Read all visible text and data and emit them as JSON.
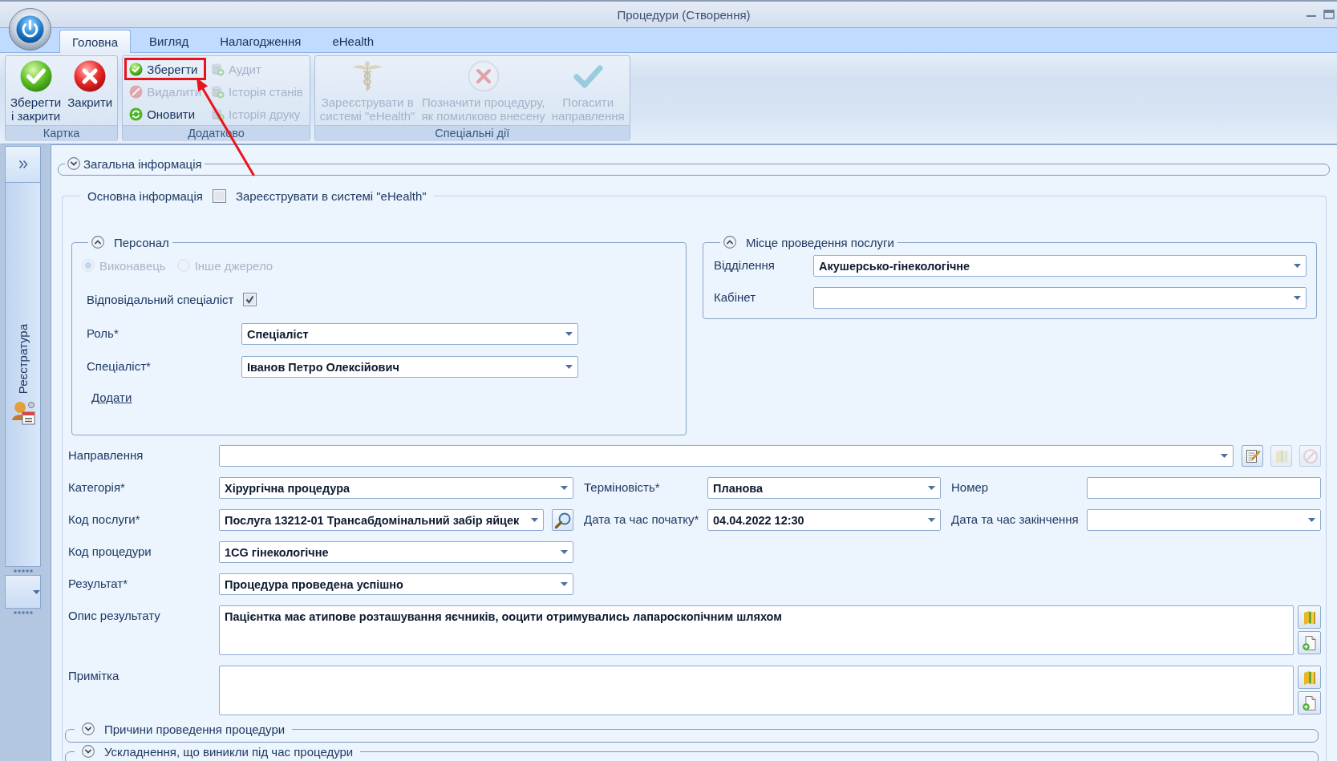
{
  "window": {
    "title": "Процедури (Створення)"
  },
  "tabs": [
    {
      "label": "Головна",
      "selected": true
    },
    {
      "label": "Вигляд",
      "selected": false
    },
    {
      "label": "Налагодження",
      "selected": false
    },
    {
      "label": "eHealth",
      "selected": false
    }
  ],
  "ribbon": {
    "groups": [
      {
        "label": "Картка",
        "kind": "large",
        "buttons": [
          {
            "label": "Зберегти\nі закрити",
            "disabled": false,
            "highlighted": false
          },
          {
            "label": "Закрити",
            "disabled": false,
            "highlighted": false
          }
        ]
      },
      {
        "label": "Додатково",
        "kind": "small",
        "buttons": [
          {
            "label": "Зберегти",
            "disabled": false,
            "highlighted": true
          },
          {
            "label": "Видалити",
            "disabled": true,
            "highlighted": false
          },
          {
            "label": "Оновити",
            "disabled": false,
            "highlighted": false
          },
          {
            "label": "Аудит",
            "disabled": true,
            "highlighted": false
          },
          {
            "label": "Історія станів",
            "disabled": true,
            "highlighted": false
          },
          {
            "label": "Історія друку",
            "disabled": true,
            "highlighted": false
          }
        ]
      },
      {
        "label": "Спеціальні дії",
        "kind": "large",
        "buttons": [
          {
            "label": "Зареєструвати в\nсистемі \"eHealth\"",
            "disabled": true,
            "highlighted": false
          },
          {
            "label": "Позначити процедуру,\nяк помилково внесену",
            "disabled": true,
            "highlighted": false
          },
          {
            "label": "Погасити\nнаправлення",
            "disabled": true,
            "highlighted": false
          }
        ]
      }
    ]
  },
  "sidebar": {
    "title": "Реєстратура"
  },
  "general": {
    "title": "Загальна інформація",
    "expanded": false
  },
  "main_info": {
    "title": "Основна інформація",
    "register": {
      "label": "Зареєструвати в системі \"eHealth\"",
      "checked": false
    }
  },
  "personnel": {
    "title": "Персонал",
    "expanded": true,
    "source_options": [
      {
        "label": "Виконавець",
        "selected": true,
        "disabled": true
      },
      {
        "label": "Інше джерело",
        "selected": false,
        "disabled": true
      }
    ],
    "responsible": {
      "label": "Відповідальний спеціаліст",
      "checked": true
    },
    "fields": [
      {
        "label": "Роль*",
        "value": "Спеціаліст"
      },
      {
        "label": "Спеціаліст*",
        "value": "Іванов Петро Олексійович"
      }
    ],
    "add_link": "Додати"
  },
  "location": {
    "title": "Місце проведення послуги",
    "expanded": true,
    "fields": [
      {
        "label": "Відділення",
        "value": "Акушерсько-гінекологічне"
      },
      {
        "label": "Кабінет"
      }
    ]
  },
  "referral": {
    "label": "Направлення",
    "buttons": [
      {
        "disabled": false
      },
      {
        "disabled": true
      },
      {
        "disabled": true
      }
    ]
  },
  "field_rows": [
    {
      "cells": [
        {
          "label": "Категорія*",
          "kind": "combo",
          "value": "Хірургічна процедура"
        },
        {
          "label": "Терміновість*",
          "kind": "combo",
          "value": "Планова"
        },
        {
          "label": "Номер",
          "kind": "text"
        }
      ]
    },
    {
      "cells": [
        {
          "label": "Код послуги*",
          "kind": "search",
          "value": "Послуга 13212-01 Трансабдомінальний забір яйцек"
        },
        {
          "label": "Дата та час початку*",
          "kind": "combo",
          "value": "04.04.2022 12:30"
        },
        {
          "label": "Дата та час закінчення",
          "kind": "combo"
        }
      ]
    },
    {
      "cells": [
        {
          "label": "Код процедури",
          "kind": "combo",
          "value": "1CG гінекологічне"
        }
      ]
    },
    {
      "cells": [
        {
          "label": "Результат*",
          "kind": "combo",
          "value": "Процедура проведена успішно"
        }
      ]
    }
  ],
  "notes": [
    {
      "label": "Опис результату",
      "value": "Пацієнтка має атипове розташування яєчників, ооцити отримувались лапароскопічним шляхом"
    },
    {
      "label": "Примітка"
    }
  ],
  "subsections": [
    {
      "title": "Причини проведення процедури",
      "expanded": false
    },
    {
      "title": "Ускладнення, що виникли під час процедури",
      "expanded": false
    }
  ]
}
